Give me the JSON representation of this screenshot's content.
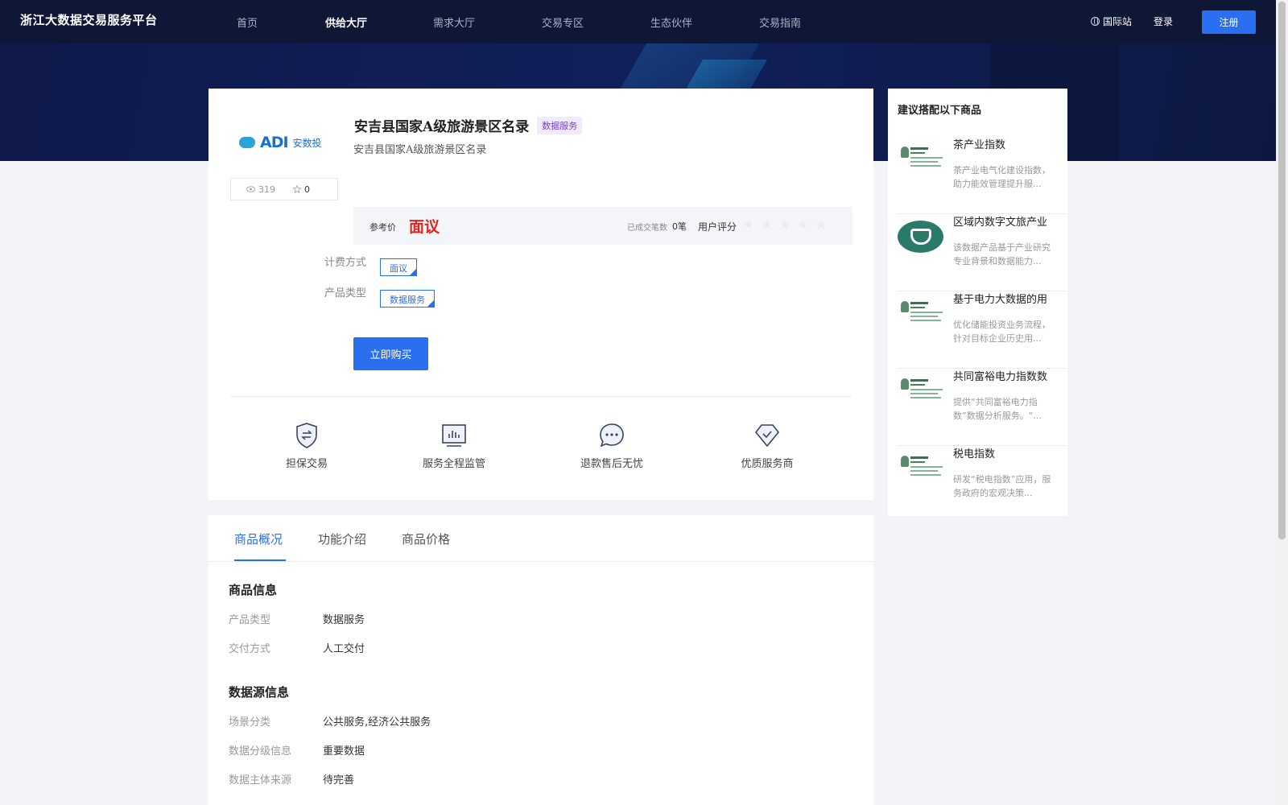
{
  "header": {
    "logo": "浙江大数据交易服务平台",
    "nav": [
      "首页",
      "供给大厅",
      "需求大厅",
      "交易专区",
      "生态伙伴",
      "交易指南"
    ],
    "intl": "国际站",
    "login": "登录",
    "register": "注册"
  },
  "product": {
    "logo_mark": "ADI",
    "logo_cn": "安数投",
    "views": "319",
    "favorites": "0",
    "title": "安吉县国家A级旅游景区名录",
    "tag": "数据服务",
    "subtitle": "安吉县国家A级旅游景区名录",
    "price_label": "参考价",
    "price": "面议",
    "deal_label": "已成交笔数",
    "deal_count": "0笔",
    "rating_label": "用户评分",
    "rating": 0,
    "billing_label": "计费方式",
    "billing_value": "面议",
    "type_label": "产品类型",
    "type_value": "数据服务",
    "buy_label": "立即购买"
  },
  "assurances": [
    "担保交易",
    "服务全程监管",
    "退款售后无忧",
    "优质服务商"
  ],
  "tabs": [
    "商品概况",
    "功能介绍",
    "商品价格"
  ],
  "goods_info": {
    "title": "商品信息",
    "rows": [
      {
        "label": "产品类型",
        "value": "数据服务"
      },
      {
        "label": "交付方式",
        "value": "人工交付"
      }
    ]
  },
  "source_info": {
    "title": "数据源信息",
    "rows": [
      {
        "label": "场景分类",
        "value": "公共服务,经济公共服务"
      },
      {
        "label": "数据分级信息",
        "value": "重要数据"
      },
      {
        "label": "数据主体来源",
        "value": "待完善"
      }
    ]
  },
  "recommend": {
    "title": "建议搭配以下商品",
    "items": [
      {
        "name": "茶产业指数",
        "desc": "茶产业电气化建设指数，助力能效管理提升服..."
      },
      {
        "name": "区域内数字文旅产业",
        "desc": "该数据产品基于产业研究专业背景和数据能力..."
      },
      {
        "name": "基于电力大数据的用",
        "desc": "优化储能投资业务流程，针对目标企业历史用..."
      },
      {
        "name": "共同富裕电力指数数",
        "desc": "提供“共同富裕电力指数”数据分析服务。“..."
      },
      {
        "name": "税电指数",
        "desc": "研发“税电指数”应用，服务政府的宏观决策..."
      }
    ]
  },
  "colors": {
    "accent": "#2a6ff0",
    "price": "#e2231a",
    "header_bg": "#0f1736"
  }
}
